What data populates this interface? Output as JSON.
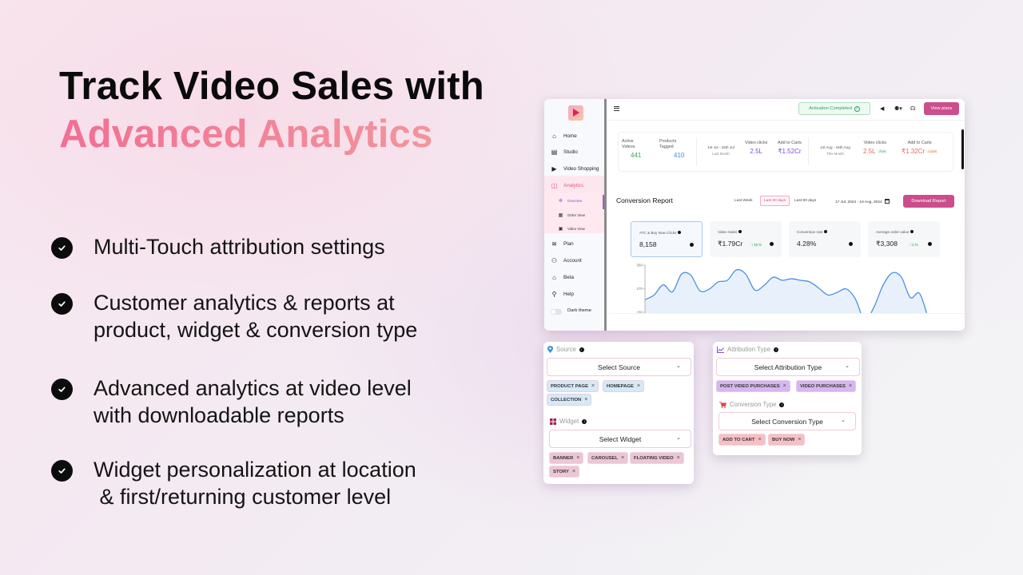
{
  "headline": {
    "line1": "Track Video Sales with",
    "line2": "Advanced Analytics"
  },
  "features": [
    {
      "text": "Multi-Touch attribution settings"
    },
    {
      "text": "Customer analytics & reports at\nproduct, widget & conversion type"
    },
    {
      "text": "Advanced analytics at video level\nwith downloadable reports"
    },
    {
      "text": "Widget personalization at location\n & first/returning customer level"
    }
  ],
  "dashboard": {
    "sidebar": {
      "items": [
        {
          "label": "Home",
          "icon": "home-icon"
        },
        {
          "label": "Studio",
          "icon": "clapperboard-icon"
        },
        {
          "label": "Video Shopping",
          "icon": "play-square-icon"
        },
        {
          "label": "Analytics",
          "icon": "chart-square-icon",
          "active": true
        },
        {
          "label": "Plan",
          "icon": "layers-icon"
        },
        {
          "label": "Account",
          "icon": "users-icon"
        },
        {
          "label": "Beta",
          "icon": "home-outline-icon"
        },
        {
          "label": "Help",
          "icon": "user-help-icon"
        }
      ],
      "subitems": [
        {
          "label": "Overview",
          "icon": "grid-icon",
          "active": true
        },
        {
          "label": "Order View",
          "icon": "table-icon"
        },
        {
          "label": "Video View",
          "icon": "video-icon"
        }
      ],
      "dark_theme_label": "Dark theme"
    },
    "topbar": {
      "activation_label": "Activation Completed",
      "view_plans_label": "View plans"
    },
    "stats": {
      "active_videos_label": "Active\nVideos",
      "active_videos": "441",
      "products_tagged_label": "Products\nTagged",
      "products_tagged": "410",
      "last_month": {
        "range": "1st Jul - 16th Jul",
        "caption": "Last Month",
        "video_clicks_label": "Video clicks",
        "video_clicks": "2.5L",
        "add_to_carts_label": "Add to Carts",
        "add_to_carts": "₹1.52Cr"
      },
      "this_month": {
        "range": "1st Aug - 16th Aug",
        "caption": "This Month",
        "video_clicks_label": "Video clicks",
        "video_clicks": "2.5L",
        "video_clicks_change": "↗2%",
        "add_to_carts_label": "Add to Carts",
        "add_to_carts": "₹1.32Cr",
        "add_to_carts_change": "↘13%"
      }
    },
    "report": {
      "title": "Conversion Report",
      "ranges": [
        {
          "label": "Last Week"
        },
        {
          "label": "Last 30 days",
          "active": true
        },
        {
          "label": "Last 90 days"
        }
      ],
      "date_range": "17 Jul, 2024 - 16 Aug, 2024",
      "download_label": "Download Report",
      "metrics": [
        {
          "label": "ATC & Buy Now Clicks",
          "value": "8,158",
          "selected": true
        },
        {
          "label": "Video Sales",
          "value": "₹1.79Cr",
          "change": "↑ 16 %"
        },
        {
          "label": "Conversion rate",
          "value": "4.28%"
        },
        {
          "label": "Average order value",
          "value": "₹3,308",
          "change": "↑ 2 %"
        }
      ]
    }
  },
  "chart_data": {
    "type": "area",
    "title": "",
    "xlabel": "",
    "ylabel": "",
    "y_ticks": [
      "180",
      "270",
      "360"
    ],
    "ylim": [
      180,
      360
    ],
    "values": [
      228,
      246,
      285,
      258,
      326,
      322,
      262,
      268,
      296,
      302,
      342,
      326,
      265,
      282,
      314,
      302,
      308,
      302,
      296,
      272,
      246,
      256,
      269,
      230,
      150,
      198,
      282,
      330,
      315,
      236,
      252,
      150
    ],
    "color": "#4a90e2",
    "fill": "#e8f1fb"
  },
  "filters": {
    "source": {
      "title": "Source",
      "select_label": "Select Source",
      "chips": [
        "PRODUCT PAGE",
        "HOMEPAGE",
        "COLLECTION"
      ]
    },
    "widget": {
      "title": "Widget",
      "select_label": "Select Widget",
      "chips": [
        "BANNER",
        "CAROUSEL",
        "FLOATING VIDEO",
        "STORY"
      ]
    },
    "attribution": {
      "title": "Attribution Type",
      "select_label": "Select Attribution Type",
      "chips": [
        "POST VIDEO PURCHASES",
        "VIDEO PURCHASES"
      ]
    },
    "conversion": {
      "title": "Conversion Type",
      "select_label": "Select Conversion Type",
      "chips": [
        "ADD TO CART",
        "BUY NOW"
      ]
    }
  },
  "colors": {
    "accent": "#cb4d8c",
    "headline_gradient_start": "#f16f93",
    "headline_gradient_end": "#f39a9e",
    "success": "#2a9c5b",
    "danger": "#ef5f5f"
  }
}
